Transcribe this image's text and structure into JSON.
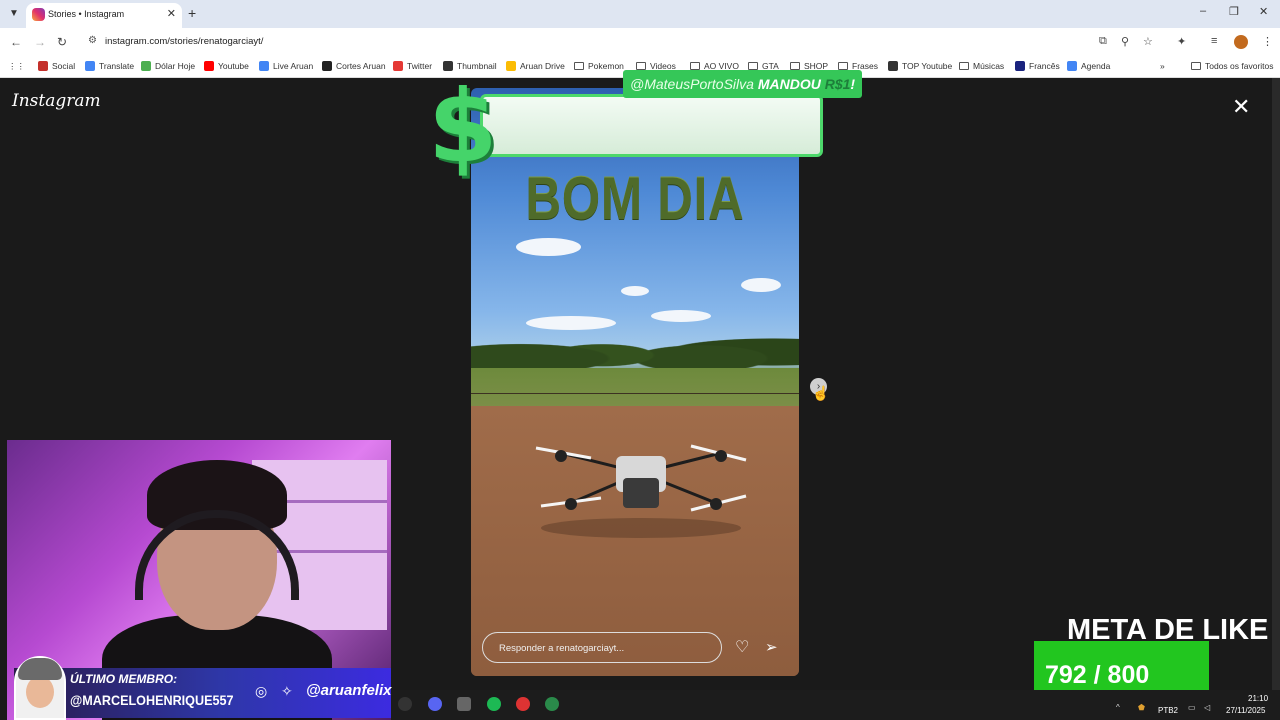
{
  "browser": {
    "tab_title": "Stories • Instagram",
    "url": "instagram.com/stories/renatogarciayt/",
    "bookmarks": [
      {
        "label": "Social",
        "icon": "social-icon",
        "color": "#c4302b"
      },
      {
        "label": "Translate",
        "icon": "translate-icon",
        "color": "#4285f4"
      },
      {
        "label": "Dólar Hoje",
        "icon": "dollar-icon",
        "color": "#4caf50"
      },
      {
        "label": "Youtube",
        "icon": "youtube-icon",
        "color": "#ff0000"
      },
      {
        "label": "Live Aruan",
        "icon": "doc-icon",
        "color": "#4285f4"
      },
      {
        "label": "Cortes Aruan",
        "icon": "notion-icon",
        "color": "#222222"
      },
      {
        "label": "Twitter",
        "icon": "flash-icon",
        "color": "#e53935"
      },
      {
        "label": "Thumbnail",
        "icon": "download-icon",
        "color": "#333333"
      },
      {
        "label": "Aruan Drive",
        "icon": "drive-icon",
        "color": "#fbbc04"
      },
      {
        "label": "Pokemon",
        "icon": "folder-icon",
        "color": ""
      },
      {
        "label": "Videos",
        "icon": "folder-icon",
        "color": ""
      },
      {
        "label": "AO VIVO",
        "icon": "folder-icon",
        "color": ""
      },
      {
        "label": "GTA",
        "icon": "folder-icon",
        "color": ""
      },
      {
        "label": "SHOP",
        "icon": "folder-icon",
        "color": ""
      },
      {
        "label": "Frases",
        "icon": "folder-icon",
        "color": ""
      },
      {
        "label": "TOP Youtube",
        "icon": "grid-icon",
        "color": "#333333"
      },
      {
        "label": "Músicas",
        "icon": "folder-icon",
        "color": ""
      },
      {
        "label": "Francês",
        "icon": "french-icon",
        "color": "#1a237e"
      },
      {
        "label": "Agenda",
        "icon": "calendar-icon",
        "color": "#4285f4"
      }
    ],
    "all_bookmarks": "Todos os favoritos"
  },
  "instagram": {
    "logo": "Instagram",
    "story_text": "BOM DIA",
    "reply_placeholder": "Responder a renatogarciayt..."
  },
  "alert": {
    "donor": "@MateusPortoSilva",
    "action": "MANDOU",
    "amount": "R$1",
    "punct": "!"
  },
  "stream": {
    "member_label": "ÚLTIMO MEMBRO:",
    "member_name": "@MARCELOHENRIQUE557",
    "handle": "@aruanfelix",
    "goal_title": "META DE LIKE",
    "goal_count": "792 / 800"
  },
  "taskbar": {
    "lang": "PTB2",
    "time": "21:10",
    "date": "27/11/2025"
  }
}
